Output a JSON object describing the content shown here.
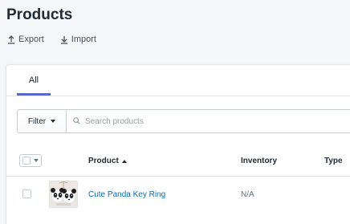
{
  "page": {
    "title": "Products"
  },
  "actions": {
    "export_label": "Export",
    "import_label": "Import"
  },
  "tabs": [
    {
      "label": "All",
      "active": true
    }
  ],
  "filter": {
    "button_label": "Filter",
    "search_placeholder": "Search products",
    "search_value": ""
  },
  "table": {
    "headers": {
      "product": "Product",
      "inventory": "Inventory",
      "type": "Type"
    },
    "rows": [
      {
        "product": "Cute Panda Key Ring",
        "inventory": "N/A",
        "type": "",
        "thumbnail_icon": "panda-keyring-image"
      }
    ]
  },
  "colors": {
    "accent": "#5c6ac4",
    "link": "#006fbb",
    "background": "#f4f6f8",
    "text": "#212b36",
    "muted": "#637381"
  }
}
